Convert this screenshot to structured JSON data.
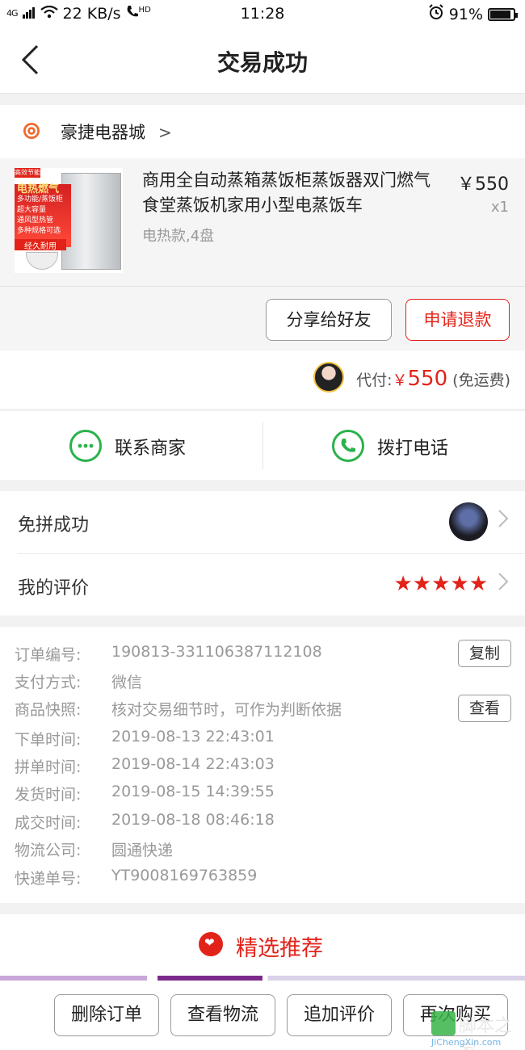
{
  "status_bar": {
    "signal": "4G",
    "speed": "22 KB/s",
    "hd": "HD",
    "time": "11:28",
    "battery": "91%",
    "battery_level": 0.91
  },
  "nav": {
    "title": "交易成功"
  },
  "shop": {
    "name": "豪捷电器城",
    "chevron": ">"
  },
  "product": {
    "title": "商用全自动蒸箱蒸饭柜蒸饭器双门燃气食堂蒸饭机家用小型电蒸饭车",
    "spec": "电热款,4盘",
    "price": "￥550",
    "qty": "x1",
    "thumb": {
      "tag": "高效节能",
      "headline": "电热燃气",
      "line1": "多功能/蒸饭柜",
      "line2": "超大容量",
      "line3": "通风型热管",
      "line4": "多种规格可选",
      "badge": "经久耐用"
    }
  },
  "actions": {
    "share": "分享给好友",
    "refund": "申请退款"
  },
  "payment": {
    "label": "代付:",
    "yen": "￥",
    "amount": "550",
    "note": "(免运费)"
  },
  "contact": {
    "merchant": "联系商家",
    "call": "拨打电话"
  },
  "rows": {
    "group": "免拼成功",
    "review": "我的评价",
    "stars": "★★★★★",
    "rating": 5
  },
  "order": {
    "items": [
      {
        "key": "订单编号:",
        "value": "190813-331106387112108"
      },
      {
        "key": "支付方式:",
        "value": "微信"
      },
      {
        "key": "商品快照:",
        "value": "核对交易细节时，可作为判断依据"
      },
      {
        "key": "下单时间:",
        "value": "2019-08-13 22:43:01"
      },
      {
        "key": "拼单时间:",
        "value": "2019-08-14 22:43:03"
      },
      {
        "key": "发货时间:",
        "value": "2019-08-15 14:39:55"
      },
      {
        "key": "成交时间:",
        "value": "2019-08-18 08:46:18"
      },
      {
        "key": "物流公司:",
        "value": "圆通快递"
      },
      {
        "key": "快递单号:",
        "value": "YT9008169763859"
      }
    ],
    "copy": "复制",
    "view": "查看"
  },
  "recommend": {
    "title": "精选推荐"
  },
  "bottom": {
    "delete": "删除订单",
    "logistics": "查看物流",
    "append": "追加评价",
    "rebuy": "再次购买"
  },
  "watermark": {
    "big": "脚本之家",
    "small": "JiChengXin.com"
  },
  "colors": {
    "accent": "#e2231a",
    "green": "#2bb24c"
  }
}
